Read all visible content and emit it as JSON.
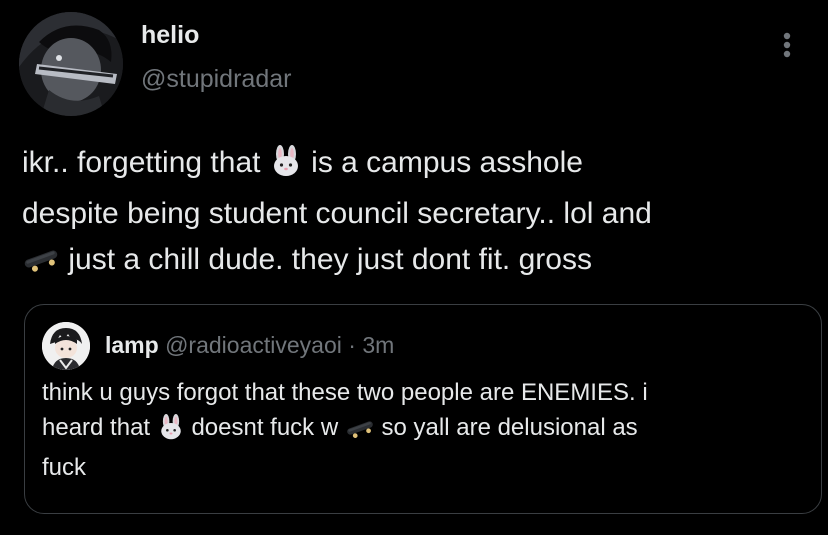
{
  "post": {
    "author_name": "helio",
    "author_handle": "@stupidradar",
    "more_icon": "more-vertical-icon",
    "text": {
      "l1_a": "ikr.. forgetting that",
      "l1_b": "is a campus asshole",
      "l2": "despite being student council secretary.. lol and",
      "l3": "just a chill dude. they just dont fit. gross"
    }
  },
  "quote": {
    "author_name": "lamp",
    "author_handle": "@radioactiveyaoi",
    "separator": "·",
    "time": "3m",
    "text": {
      "l1": "think u guys forgot that these two people are ENEMIES. i",
      "l2_a": "heard that",
      "l2_b": "doesnt fuck w",
      "l2_c": "so yall are delusional as",
      "l3": "fuck"
    }
  },
  "colors": {
    "background": "#000000",
    "text": "#e7e9ea",
    "secondary_text": "#71767b",
    "border": "#3a3e42"
  },
  "emojis": [
    "rabbit-face-emoji",
    "skateboard-emoji"
  ]
}
